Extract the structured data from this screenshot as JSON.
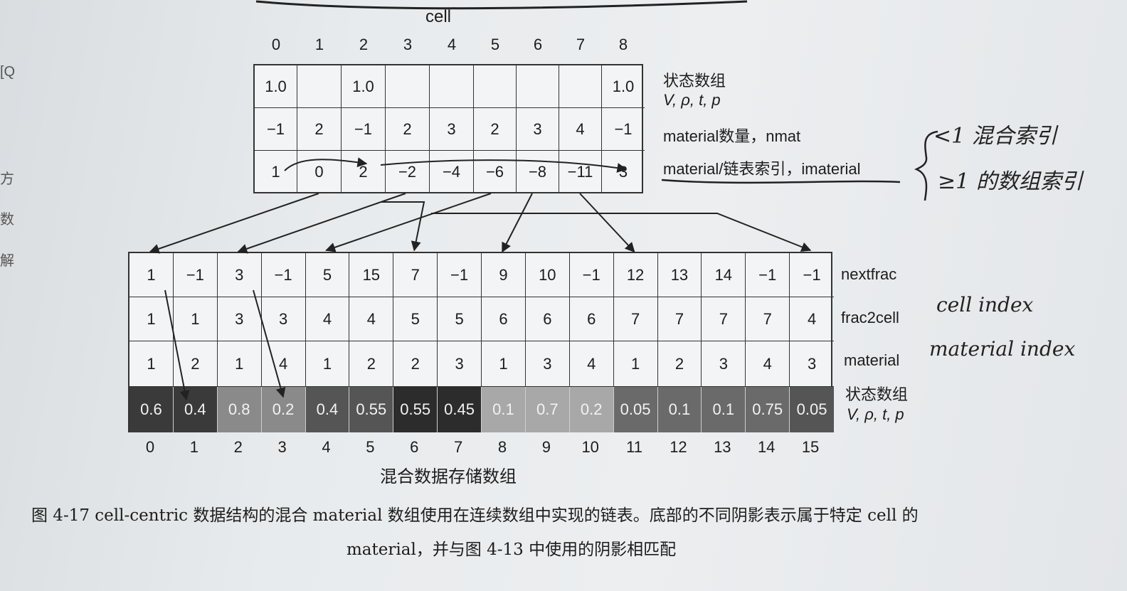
{
  "top_title": "cell",
  "cell_indices": [
    "0",
    "1",
    "2",
    "3",
    "4",
    "5",
    "6",
    "7",
    "8"
  ],
  "state_row": [
    "1.0",
    "",
    "1.0",
    "",
    "",
    "",
    "",
    "",
    "1.0"
  ],
  "nmat_row": [
    "−1",
    "2",
    "−1",
    "2",
    "3",
    "2",
    "3",
    "4",
    "−1"
  ],
  "imaterial_row": [
    "1",
    "0",
    "2",
    "−2",
    "−4",
    "−6",
    "−8",
    "−11",
    "3"
  ],
  "top_labels": {
    "state_title": "状态数组",
    "state_vars": "V, ρ, t, p",
    "nmat": "material数量，nmat",
    "imaterial": "material/链表索引，imaterial"
  },
  "handwritten": {
    "lt1": "<1 混合索引",
    "ge1": "≥1 的数组索引",
    "cell_index": "cell index",
    "material_index": "material index"
  },
  "nextfrac_row": [
    "1",
    "−1",
    "3",
    "−1",
    "5",
    "15",
    "7",
    "−1",
    "9",
    "10",
    "−1",
    "12",
    "13",
    "14",
    "−1",
    "−1"
  ],
  "frac2cell_row": [
    "1",
    "1",
    "3",
    "3",
    "4",
    "4",
    "5",
    "5",
    "6",
    "6",
    "6",
    "7",
    "7",
    "7",
    "7",
    "4"
  ],
  "material_row": [
    "1",
    "2",
    "1",
    "4",
    "1",
    "2",
    "2",
    "3",
    "1",
    "3",
    "4",
    "1",
    "2",
    "3",
    "4",
    "3"
  ],
  "fraction_row": [
    "0.6",
    "0.4",
    "0.8",
    "0.2",
    "0.4",
    "0.55",
    "0.55",
    "0.45",
    "0.1",
    "0.7",
    "0.2",
    "0.05",
    "0.1",
    "0.1",
    "0.75",
    "0.05"
  ],
  "fraction_shades": [
    "#3a3a3a",
    "#3a3a3a",
    "#8a8a8a",
    "#8a8a8a",
    "#555555",
    "#555555",
    "#2c2c2c",
    "#2c2c2c",
    "#a8a8a8",
    "#a8a8a8",
    "#a8a8a8",
    "#6a6a6a",
    "#6a6a6a",
    "#6a6a6a",
    "#6a6a6a",
    "#555555"
  ],
  "bottom_indices": [
    "0",
    "1",
    "2",
    "3",
    "4",
    "5",
    "6",
    "7",
    "8",
    "9",
    "10",
    "11",
    "12",
    "13",
    "14",
    "15"
  ],
  "bottom_labels": {
    "nextfrac": "nextfrac",
    "frac2cell": "frac2cell",
    "material": "material",
    "state_title": "状态数组",
    "state_vars": "V, ρ, t, p"
  },
  "bottom_title": "混合数据存储数组",
  "caption_line1": "图 4-17   cell-centric 数据结构的混合 material 数组使用在连续数组中实现的链表。底部的不同阴影表示属于特定 cell 的",
  "caption_line2": "material，并与图 4-13 中使用的阴影相匹配"
}
